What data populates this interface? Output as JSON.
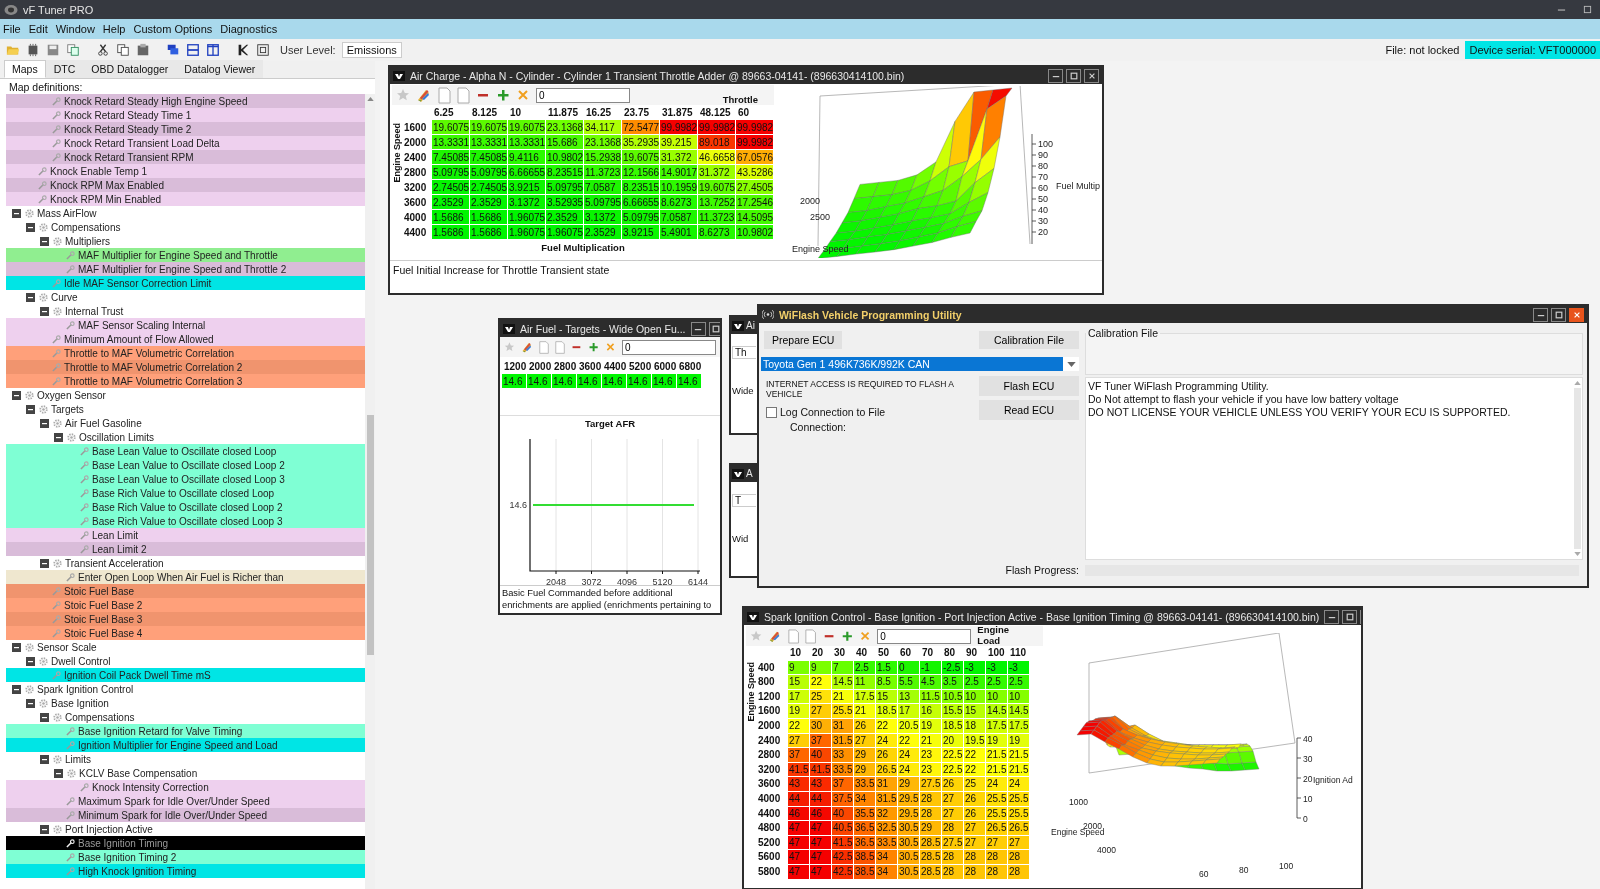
{
  "app": {
    "title": "vF Tuner PRO"
  },
  "menu": [
    "File",
    "Edit",
    "Window",
    "Help",
    "Custom Options",
    "Diagnostics"
  ],
  "toolbar": {
    "user_level_label": "User Level:",
    "user_level": "Emissions",
    "file_status": "File: not locked",
    "device_serial": "Device serial: VFT000000"
  },
  "tabs": [
    {
      "label": "Maps",
      "selected": true
    },
    {
      "label": "DTC",
      "selected": false
    },
    {
      "label": "OBD Datalogger",
      "selected": false
    },
    {
      "label": "Datalog Viewer",
      "selected": false
    }
  ],
  "tree": {
    "heading": "Map definitions:",
    "items": [
      {
        "children": [
          {
            "children": [
              {
                "label": "Knock Retard Steady High Engine Speed",
                "selected": false,
                "color": "#d9bcd9"
              },
              {
                "label": "Knock Retard Steady Time 1",
                "selected": false,
                "color": "#eed0ee"
              },
              {
                "label": "Knock Retard Steady Time 2",
                "selected": false,
                "color": "#d9bcd9"
              },
              {
                "label": "Knock Retard Transient Load Delta",
                "selected": false,
                "color": "#eed0ee"
              },
              {
                "label": "Knock Retard Transient RPM",
                "selected": false,
                "color": "#d9bcd9"
              }
            ]
          },
          {
            "label": "Knock Enable Temp 1",
            "selected": false,
            "color": "#eed0ee"
          },
          {
            "label": "Knock RPM Max Enabled",
            "selected": false,
            "color": "#d9bcd9"
          },
          {
            "label": "Knock RPM Min Enabled",
            "selected": false,
            "color": "#eed0ee"
          }
        ]
      },
      {
        "label": "Mass AirFlow",
        "expanded": true,
        "selected": false,
        "children": [
          {
            "label": "Compensations",
            "expanded": true,
            "selected": false,
            "children": [
              {
                "label": "Multipliers",
                "expanded": true,
                "selected": false,
                "children": [
                  {
                    "label": "MAF Multiplier for Engine Speed and Throttle",
                    "selected": false,
                    "color": "#90ee90"
                  },
                  {
                    "label": "MAF Multiplier for Engine Speed and Throttle 2",
                    "selected": false,
                    "color": "#d9bcd9"
                  }
                ]
              },
              {
                "label": "Idle MAF Sensor Correction Limit",
                "selected": false,
                "color": "#00e5e5"
              }
            ]
          },
          {
            "label": "Curve",
            "expanded": true,
            "selected": false,
            "children": [
              {
                "label": "Internal Trust",
                "expanded": true,
                "selected": false,
                "children": [
                  {
                    "label": "MAF Sensor Scaling Internal",
                    "selected": false,
                    "color": "#eed0ee"
                  }
                ]
              },
              {
                "label": "Minimum Amount of Flow Allowed",
                "selected": false,
                "color": "#eed0ee"
              },
              {
                "label": "Throttle to MAF Volumetric Correlation",
                "selected": false,
                "color": "#ffa07a"
              },
              {
                "label": "Throttle to MAF Volumetric Correlation 2",
                "selected": false,
                "color": "#f0946e"
              },
              {
                "label": "Throttle to MAF Volumetric Correlation 3",
                "selected": false,
                "color": "#ffa07a"
              }
            ]
          }
        ]
      },
      {
        "label": "Oxygen Sensor",
        "expanded": true,
        "selected": false,
        "children": [
          {
            "label": "Targets",
            "expanded": true,
            "selected": false,
            "children": [
              {
                "label": "Air Fuel Gasoline",
                "expanded": true,
                "selected": false,
                "children": [
                  {
                    "label": "Oscillation Limits",
                    "expanded": true,
                    "selected": false,
                    "children": [
                      {
                        "label": "Base Lean Value to Oscillate closed Loop",
                        "selected": false,
                        "color": "#7fffd4"
                      },
                      {
                        "label": "Base Lean Value to Oscillate closed Loop 2",
                        "selected": false,
                        "color": "#7fffd4"
                      },
                      {
                        "label": "Base Lean Value to Oscillate closed Loop 3",
                        "selected": false,
                        "color": "#7fffd4"
                      },
                      {
                        "label": "Base Rich Value to Oscillate closed Loop",
                        "selected": false,
                        "color": "#7fffd4"
                      },
                      {
                        "label": "Base Rich Value to Oscillate closed Loop 2",
                        "selected": false,
                        "color": "#7fffd4"
                      },
                      {
                        "label": "Base Rich Value to Oscillate closed Loop 3",
                        "selected": false,
                        "color": "#7fffd4"
                      },
                      {
                        "label": "Lean Limit",
                        "selected": false,
                        "color": "#eed0ee"
                      },
                      {
                        "label": "Lean Limit 2",
                        "selected": false,
                        "color": "#d9bcd9"
                      }
                    ]
                  }
                ]
              },
              {
                "label": "Transient Acceleration",
                "expanded": true,
                "selected": false,
                "children": [
                  {
                    "label": "Enter Open Loop When Air Fuel is Richer than",
                    "selected": false,
                    "color": "#efe7cf"
                  }
                ]
              },
              {
                "label": "Stoic Fuel Base",
                "selected": false,
                "color": "#f0946e"
              },
              {
                "label": "Stoic Fuel Base 2",
                "selected": false,
                "color": "#ffa07a"
              },
              {
                "label": "Stoic Fuel Base 3",
                "selected": false,
                "color": "#f0946e"
              },
              {
                "label": "Stoic Fuel Base 4",
                "selected": false,
                "color": "#ffa07a"
              }
            ]
          }
        ]
      },
      {
        "label": "Sensor Scale",
        "expanded": true,
        "selected": false,
        "children": [
          {
            "label": "Dwell Control",
            "expanded": true,
            "selected": false,
            "children": [
              {
                "label": "Ignition Coil Pack Dwell Time mS",
                "selected": false,
                "color": "#00e5e5"
              }
            ]
          }
        ]
      },
      {
        "label": "Spark Ignition Control",
        "expanded": true,
        "selected": false,
        "children": [
          {
            "label": "Base Ignition",
            "expanded": true,
            "selected": false,
            "children": [
              {
                "label": "Compensations",
                "expanded": true,
                "selected": false,
                "children": [
                  {
                    "label": "Base Ignition Retard for Valve Timing",
                    "selected": false,
                    "color": "#7fffd4"
                  },
                  {
                    "label": "Ignition Multiplier for Engine Speed and Load",
                    "selected": false,
                    "color": "#00e5e5"
                  }
                ]
              },
              {
                "label": "Limits",
                "expanded": true,
                "selected": false,
                "children": [
                  {
                    "label": "KCLV Base Compensation",
                    "expanded": true,
                    "selected": false,
                    "children": [
                      {
                        "label": "Knock Intensity Correction",
                        "selected": false,
                        "color": "#eed0ee"
                      }
                    ]
                  },
                  {
                    "label": "Maximum Spark for Idle Over/Under Speed",
                    "selected": false,
                    "color": "#eed0ee"
                  },
                  {
                    "label": "Minimum Spark for Idle Over/Under Speed",
                    "selected": false,
                    "color": "#d9bcd9"
                  }
                ]
              },
              {
                "label": "Port Injection Active",
                "expanded": true,
                "selected": false,
                "children": [
                  {
                    "label": "Base Ignition Timing",
                    "selected": true
                  },
                  {
                    "label": "Base Ignition Timing 2",
                    "selected": false,
                    "color": "#7fffd4"
                  },
                  {
                    "label": "High Knock Ignition Timing",
                    "selected": false,
                    "color": "#00e5e5"
                  }
                ]
              }
            ]
          }
        ]
      }
    ]
  },
  "air_charge": {
    "title": "Air Charge - Alpha N - Cylinder - Cylinder 1 Transient Throttle Adder @ 89663-04141- (896630414100.bin)",
    "input": "0",
    "x_axis_label": "Throttle",
    "y_axis_label": "Engine Speed",
    "table_label": "Fuel Multiplication",
    "columns": [
      "6.25",
      "8.125",
      "10",
      "11.875",
      "16.25",
      "23.75",
      "31.875",
      "48.125",
      "60"
    ],
    "rows": [
      {
        "header": "1600",
        "cells": [
          "19.6075",
          "19.6075",
          "19.6075",
          "23.1368",
          "34.117",
          "72.5477",
          "99.9982",
          "99.9982",
          "99.9982"
        ]
      },
      {
        "header": "2000",
        "cells": [
          "13.3331",
          "13.3331",
          "13.3331",
          "15.686",
          "23.1368",
          "35.2935",
          "39.215",
          "89.018",
          "99.9982"
        ]
      },
      {
        "header": "2400",
        "cells": [
          "7.45085",
          "7.45085",
          "9.4116",
          "10.9802",
          "15.2938",
          "19.6075",
          "31.372",
          "46.6658",
          "67.0576"
        ]
      },
      {
        "header": "2800",
        "cells": [
          "5.09795",
          "5.09795",
          "6.66655",
          "8.23515",
          "11.3723",
          "12.1566",
          "14.9017",
          "31.372",
          "43.5286"
        ]
      },
      {
        "header": "3200",
        "cells": [
          "2.74505",
          "2.74505",
          "3.9215",
          "5.09795",
          "7.0587",
          "8.23515",
          "10.1959",
          "19.6075",
          "27.4505"
        ]
      },
      {
        "header": "3600",
        "cells": [
          "2.3529",
          "2.3529",
          "3.1372",
          "3.52935",
          "5.09795",
          "6.66655",
          "8.6273",
          "13.7252",
          "17.2546"
        ]
      },
      {
        "header": "4000",
        "cells": [
          "1.5686",
          "1.5686",
          "1.96075",
          "2.3529",
          "3.1372",
          "5.09795",
          "7.0587",
          "11.3723",
          "14.5095"
        ]
      },
      {
        "header": "4400",
        "cells": [
          "1.5686",
          "1.5686",
          "1.96075",
          "1.96075",
          "2.3529",
          "3.9215",
          "5.4901",
          "8.6273",
          "10.9802"
        ]
      }
    ],
    "surface": {
      "z_ticks": [
        "100",
        "90",
        "80",
        "70",
        "60",
        "50",
        "40",
        "30",
        "20"
      ],
      "z_label": "Fuel Multip",
      "y_ticks": [
        "2000",
        "2500"
      ],
      "y_label": "Engine Speed"
    },
    "description": "Fuel Initial Increase for Throttle Transient state"
  },
  "air_fuel": {
    "title": "Air Fuel - Targets - Wide Open Fu...",
    "input": "0",
    "columns": [
      "1200",
      "2000",
      "2800",
      "3600",
      "4400",
      "5200",
      "6000",
      "6800"
    ],
    "cells": [
      "14.6",
      "14.6",
      "14.6",
      "14.6",
      "14.6",
      "14.6",
      "14.6",
      "14.6"
    ],
    "chart": {
      "title": "Target AFR",
      "x_ticks": [
        "2048",
        "3072",
        "4096",
        "5120",
        "6144"
      ],
      "y_tick": "14.6"
    },
    "description": "Basic Fuel Commanded before additional enrichments are applied (enrichments pertaining to"
  },
  "hidden_windows": [
    {
      "title": "Ai",
      "group": "Th",
      "text": "Wide"
    },
    {
      "title": "A",
      "group": "T",
      "text": "Wid"
    }
  ],
  "wiflash": {
    "title": "WiFlash Vehicle Programming Utility",
    "prepare_button": "Prepare ECU",
    "calibration_button": "Calibration File",
    "flash_button": "Flash ECU",
    "read_button": "Read ECU",
    "ecu_select": "Toyota Gen 1 496K736K/992K CAN",
    "notice": "INTERNET ACCESS IS REQUIRED TO FLASH A VEHICLE",
    "log_checkbox": {
      "label": "Log Connection to File",
      "checked": false
    },
    "connection_label": "Connection:",
    "calibration_group": "Calibration File",
    "log_lines": [
      "VF Tuner WiFlash Programming Utility.",
      "Do Not attempt to flash your vehicle if you have low battery voltage",
      "DO NOT LICENSE YOUR VEHICLE UNLESS YOU VERIFY YOUR ECU IS SUPPORTED."
    ],
    "progress": {
      "label": "Flash Progress:",
      "level": 0
    }
  },
  "spark": {
    "title": "Spark Ignition Control - Base Ignition - Port Injection Active - Base Ignition Timing @ 89663-04141- (896630414100.bin)",
    "input": "0",
    "x_axis_label": "Engine Load",
    "y_axis_label": "Engine Speed",
    "columns": [
      "10",
      "20",
      "30",
      "40",
      "50",
      "60",
      "70",
      "80",
      "90",
      "100",
      "110"
    ],
    "rows": [
      {
        "header": "400",
        "cells": [
          "9",
          "9",
          "7",
          "2.5",
          "1.5",
          "0",
          "-1",
          "-2.5",
          "-3",
          "-3",
          "-3"
        ]
      },
      {
        "header": "800",
        "cells": [
          "15",
          "22",
          "14.5",
          "11",
          "8.5",
          "5.5",
          "4.5",
          "3.5",
          "2.5",
          "2.5",
          "2.5"
        ]
      },
      {
        "header": "1200",
        "cells": [
          "17",
          "25",
          "21",
          "17.5",
          "15",
          "13",
          "11.5",
          "10.5",
          "10",
          "10",
          "10"
        ]
      },
      {
        "header": "1600",
        "cells": [
          "19",
          "27",
          "25.5",
          "21",
          "18.5",
          "17",
          "16",
          "15.5",
          "15",
          "14.5",
          "14.5"
        ]
      },
      {
        "header": "2000",
        "cells": [
          "22",
          "30",
          "31",
          "26",
          "22",
          "20.5",
          "19",
          "18.5",
          "18",
          "17.5",
          "17.5"
        ]
      },
      {
        "header": "2400",
        "cells": [
          "27",
          "37",
          "31.5",
          "27",
          "24",
          "22",
          "21",
          "20",
          "19.5",
          "19",
          "19"
        ]
      },
      {
        "header": "2800",
        "cells": [
          "37",
          "40",
          "33",
          "29",
          "26",
          "24",
          "23",
          "22.5",
          "22",
          "21.5",
          "21.5"
        ]
      },
      {
        "header": "3200",
        "cells": [
          "41.5",
          "41.5",
          "33.5",
          "29",
          "26.5",
          "24",
          "23",
          "22.5",
          "22",
          "21.5",
          "21.5"
        ]
      },
      {
        "header": "3600",
        "cells": [
          "43",
          "43",
          "37",
          "33.5",
          "31",
          "29",
          "27.5",
          "26",
          "25",
          "24",
          "24"
        ]
      },
      {
        "header": "4000",
        "cells": [
          "44",
          "44",
          "37.5",
          "34",
          "31.5",
          "29.5",
          "28",
          "27",
          "26",
          "25.5",
          "25.5"
        ]
      },
      {
        "header": "4400",
        "cells": [
          "46",
          "46",
          "40",
          "35.5",
          "32",
          "29.5",
          "28",
          "27",
          "26",
          "25.5",
          "25.5"
        ]
      },
      {
        "header": "4800",
        "cells": [
          "47",
          "47",
          "40.5",
          "36.5",
          "32.5",
          "30.5",
          "29",
          "28",
          "27",
          "26.5",
          "26.5"
        ]
      },
      {
        "header": "5200",
        "cells": [
          "47",
          "47",
          "41.5",
          "36.5",
          "33.5",
          "30.5",
          "28.5",
          "27.5",
          "27",
          "27",
          "27"
        ]
      },
      {
        "header": "5600",
        "cells": [
          "47",
          "47",
          "42.5",
          "38.5",
          "34",
          "30.5",
          "28.5",
          "28",
          "28",
          "28",
          "28"
        ]
      },
      {
        "header": "5800",
        "cells": [
          "47",
          "47",
          "42.5",
          "38.5",
          "34",
          "30.5",
          "28.5",
          "28",
          "28",
          "28",
          "28"
        ]
      }
    ],
    "surface": {
      "z_ticks": [
        "40",
        "30",
        "20",
        "10",
        "0"
      ],
      "z_label": "Ignition Ad",
      "y_ticks": [
        "1000",
        "2000",
        "4000"
      ],
      "y_label": "Engine Speed",
      "x_ticks": [
        "60",
        "80",
        "100"
      ]
    }
  }
}
